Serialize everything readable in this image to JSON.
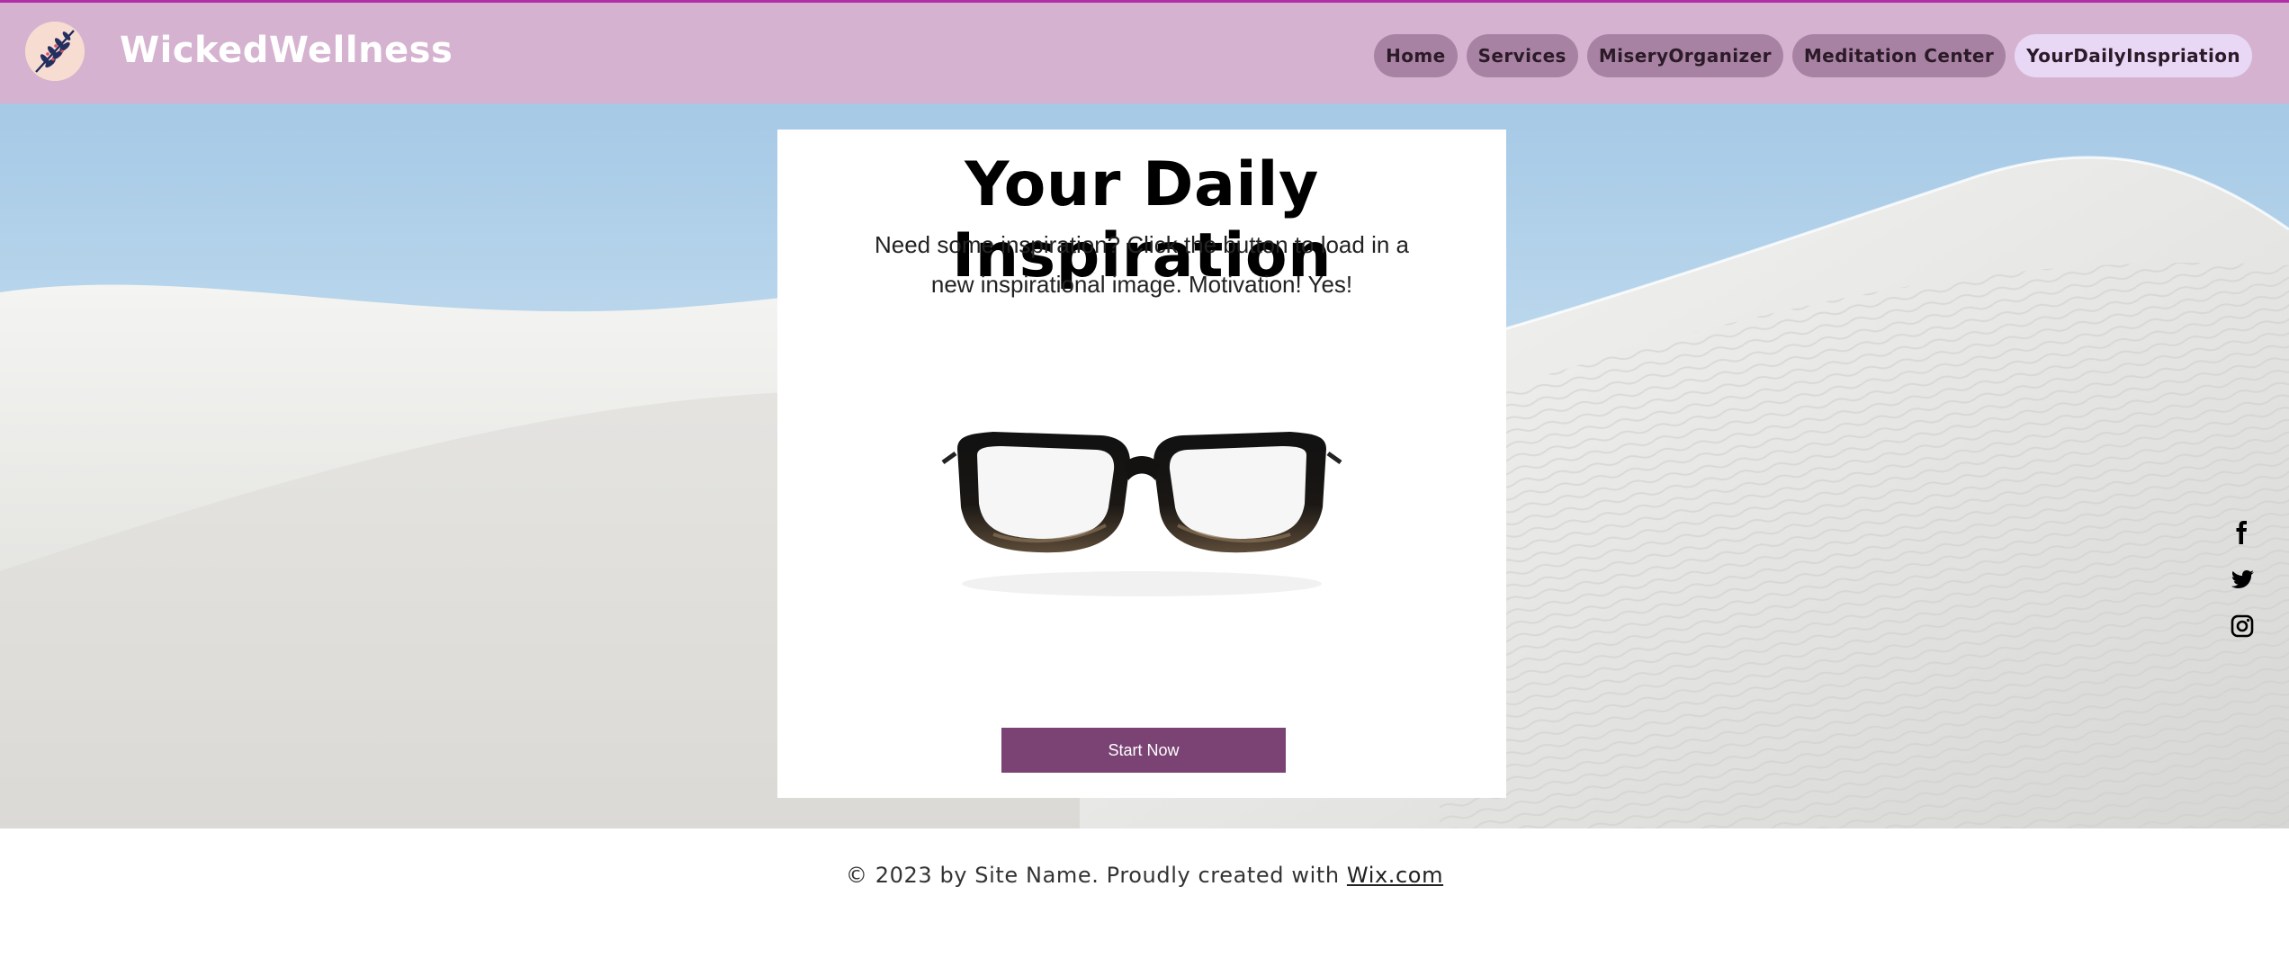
{
  "header": {
    "brand": "WickedWellness",
    "nav": [
      {
        "label": "Home",
        "active": false
      },
      {
        "label": "Services",
        "active": false
      },
      {
        "label": "MiseryOrganizer",
        "active": false
      },
      {
        "label": "Meditation Center",
        "active": false
      },
      {
        "label": "YourDailyInspriation",
        "active": true
      }
    ]
  },
  "card": {
    "title": "Your Daily Inspiration",
    "description": "Need some inspiration? Click the button to load in a new inspirational image. Motivation! Yes!",
    "button_label": "Start Now",
    "image_icon": "eyeglasses"
  },
  "social": [
    "facebook-icon",
    "twitter-icon",
    "instagram-icon"
  ],
  "footer": {
    "text": "© 2023 by Site Name. Proudly created with ",
    "link_label": "Wix.com"
  },
  "colors": {
    "header_bg": "#d5b3d0",
    "header_border": "#b12ea6",
    "nav_pill": "#a882a3",
    "nav_active": "#e8d8f6",
    "button": "#7a4374"
  }
}
